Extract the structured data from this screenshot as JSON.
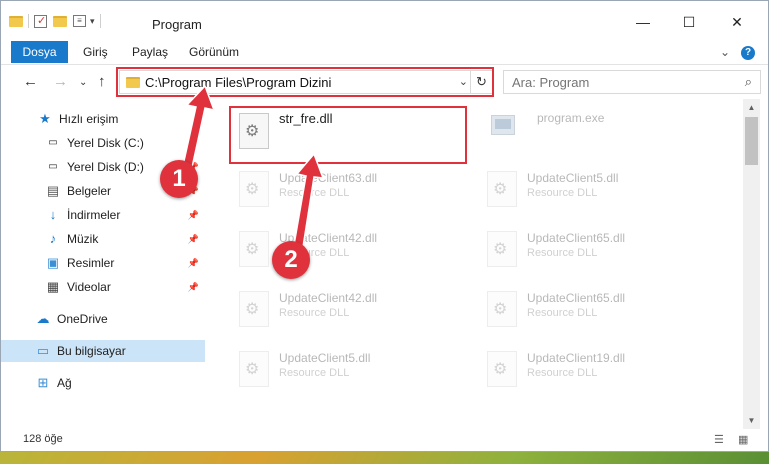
{
  "window": {
    "title": "Program",
    "minimize": "—",
    "maximize": "☐",
    "close": "✕"
  },
  "ribbon": {
    "file_tab": "Dosya",
    "tabs": [
      "Giriş",
      "Paylaş",
      "Görünüm"
    ],
    "help": "?",
    "collapse": "⌄"
  },
  "nav": {
    "back": "←",
    "forward": "→",
    "recent": "⌄",
    "up": "↑",
    "address": "C:\\Program Files\\Program Dizini",
    "address_dropdown": "⌄",
    "refresh": "↻",
    "search_placeholder": "Ara: Program",
    "search_icon": "⌕"
  },
  "sidebar": {
    "items": [
      {
        "label": "Hızlı erişim",
        "icon": "star-icon",
        "pinned": false
      },
      {
        "label": "Yerel Disk (C:)",
        "icon": "drive-icon",
        "pinned": true
      },
      {
        "label": "Yerel Disk (D:)",
        "icon": "drive-icon",
        "pinned": true
      },
      {
        "label": "Belgeler",
        "icon": "documents-icon",
        "pinned": true
      },
      {
        "label": "İndirmeler",
        "icon": "downloads-icon",
        "pinned": true
      },
      {
        "label": "Müzik",
        "icon": "music-icon",
        "pinned": true
      },
      {
        "label": "Resimler",
        "icon": "pictures-icon",
        "pinned": true
      },
      {
        "label": "Videolar",
        "icon": "videos-icon",
        "pinned": true
      },
      {
        "label": "OneDrive",
        "icon": "cloud-icon",
        "pinned": false
      },
      {
        "label": "Bu bilgisayar",
        "icon": "computer-icon",
        "pinned": false
      },
      {
        "label": "Ağ",
        "icon": "network-icon",
        "pinned": false
      }
    ]
  },
  "files": {
    "highlighted": {
      "name": "str_fre.dll"
    },
    "exe": {
      "name": "program.exe"
    },
    "items": [
      {
        "name": "UpdateClient63.dll",
        "type": "Resource DLL"
      },
      {
        "name": "UpdateClient5.dll",
        "type": "Resource DLL"
      },
      {
        "name": "UpdateClient42.dll",
        "type": "Resource DLL"
      },
      {
        "name": "UpdateClient65.dll",
        "type": "Resource DLL"
      },
      {
        "name": "UpdateClient42.dll",
        "type": "Resource DLL"
      },
      {
        "name": "UpdateClient65.dll",
        "type": "Resource DLL"
      },
      {
        "name": "UpdateClient5.dll",
        "type": "Resource DLL"
      },
      {
        "name": "UpdateClient19.dll",
        "type": "Resource DLL"
      }
    ]
  },
  "status": {
    "count": "128 öğe"
  },
  "steps": {
    "one": "1",
    "two": "2"
  },
  "colors": {
    "accent": "#1979ca",
    "highlight": "#e0323d",
    "selected": "#cce4f7"
  }
}
